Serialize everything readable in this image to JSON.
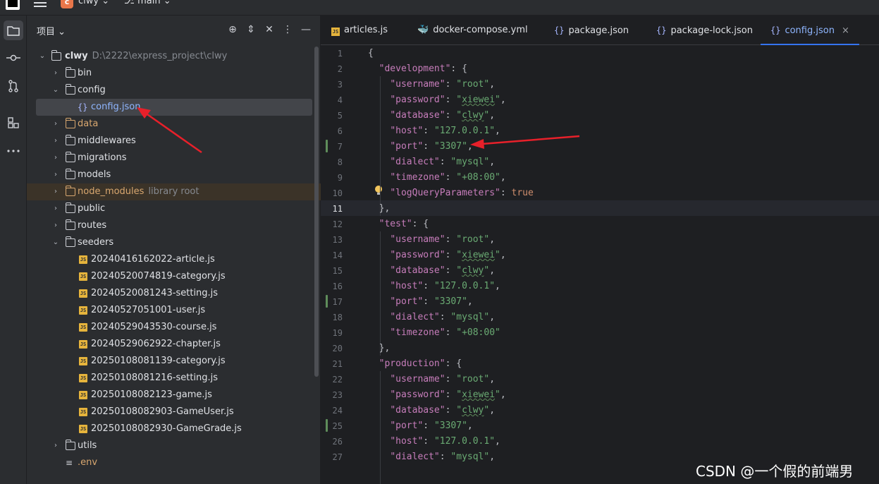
{
  "topbar": {
    "project_badge": "c",
    "project_name": "clwy ⌄",
    "branch": "⎇ main ⌄"
  },
  "panel": {
    "title": "项目 ⌄"
  },
  "tree": {
    "root": {
      "label": "clwy",
      "path": "D:\\2222\\express_project\\clwy"
    },
    "items": [
      {
        "label": "bin"
      },
      {
        "label": "config"
      },
      {
        "label": "config.json"
      },
      {
        "label": "data"
      },
      {
        "label": "middlewares"
      },
      {
        "label": "migrations"
      },
      {
        "label": "models"
      },
      {
        "label": "node_modules",
        "note": "library root"
      },
      {
        "label": "public"
      },
      {
        "label": "routes"
      },
      {
        "label": "seeders"
      },
      {
        "label": "20240416162022-article.js"
      },
      {
        "label": "20240520074819-category.js"
      },
      {
        "label": "20240520081243-setting.js"
      },
      {
        "label": "20240527051001-user.js"
      },
      {
        "label": "20240529043530-course.js"
      },
      {
        "label": "20240529062922-chapter.js"
      },
      {
        "label": "20250108081139-category.js"
      },
      {
        "label": "20250108081216-setting.js"
      },
      {
        "label": "20250108082123-game.js"
      },
      {
        "label": "20250108082903-GameUser.js"
      },
      {
        "label": "20250108082930-GameGrade.js"
      },
      {
        "label": "utils"
      },
      {
        "label": ".env"
      }
    ]
  },
  "tabs": [
    {
      "label": "articles.js"
    },
    {
      "label": "docker-compose.yml"
    },
    {
      "label": "package.json"
    },
    {
      "label": "package-lock.json"
    },
    {
      "label": "config.json",
      "close": "×"
    }
  ],
  "code": {
    "line_numbers": [
      "1",
      "2",
      "3",
      "4",
      "5",
      "6",
      "7",
      "8",
      "9",
      "10",
      "11",
      "12",
      "13",
      "14",
      "15",
      "16",
      "17",
      "18",
      "19",
      "20",
      "21",
      "22",
      "23",
      "24",
      "25",
      "26",
      "27"
    ],
    "lines": [
      "{",
      "  \"development\": {",
      "    \"username\": \"root\",",
      "    \"password\": \"xiewei\",",
      "    \"database\": \"clwy\",",
      "    \"host\": \"127.0.0.1\",",
      "    \"port\": \"3307\",",
      "    \"dialect\": \"mysql\",",
      "    \"timezone\": \"+08:00\",",
      "    \"logQueryParameters\": true",
      "  },",
      "  \"test\": {",
      "    \"username\": \"root\",",
      "    \"password\": \"xiewei\",",
      "    \"database\": \"clwy\",",
      "    \"host\": \"127.0.0.1\",",
      "    \"port\": \"3307\",",
      "    \"dialect\": \"mysql\",",
      "    \"timezone\": \"+08:00\"",
      "  },",
      "  \"production\": {",
      "    \"username\": \"root\",",
      "    \"password\": \"xiewei\",",
      "    \"database\": \"clwy\",",
      "    \"port\": \"3307\",",
      "    \"host\": \"127.0.0.1\",",
      "    \"dialect\": \"mysql\","
    ]
  },
  "watermark": "CSDN @一个假的前端男",
  "colors": {
    "accent": "#3574f0",
    "string": "#6aab73",
    "key": "#c77dbb",
    "arrow": "#e8202a"
  }
}
